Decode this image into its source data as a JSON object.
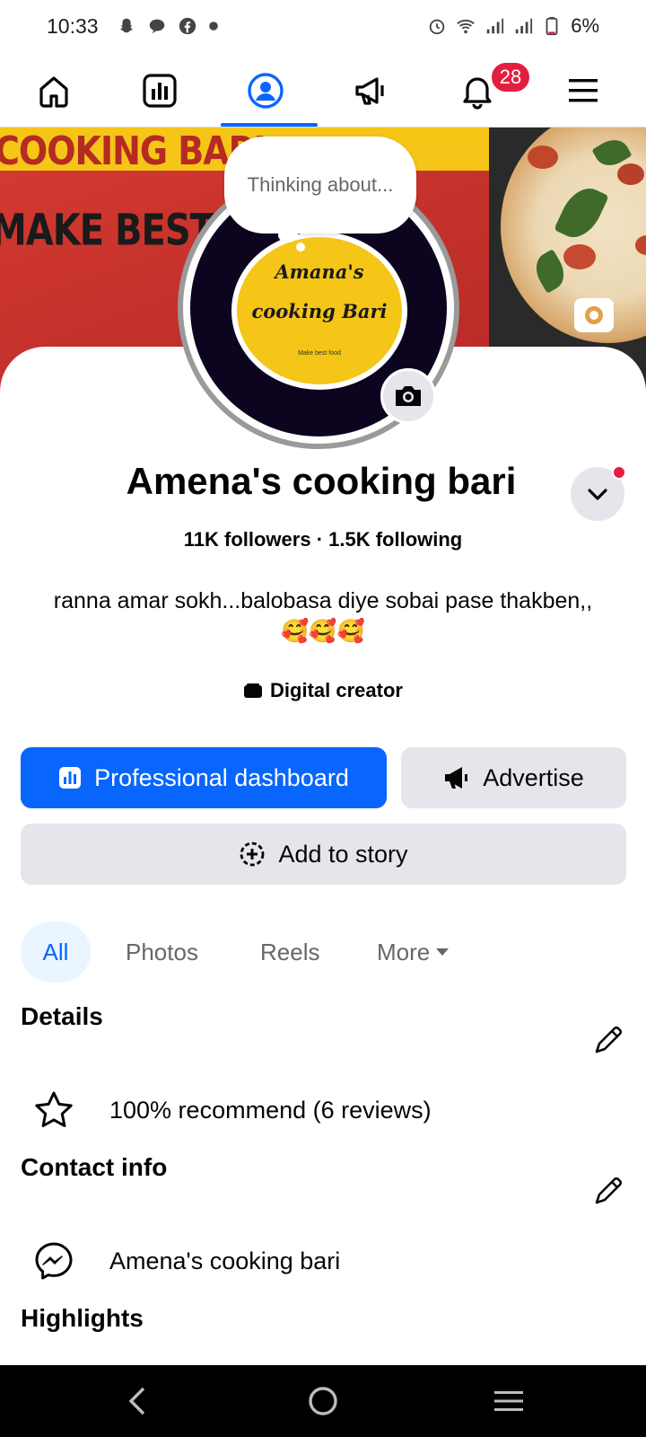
{
  "status_bar": {
    "time": "10:33",
    "battery": "6%",
    "left_icons": [
      "snapchat-icon",
      "chat-icon",
      "facebook-icon",
      "dot-icon"
    ],
    "right_icons": [
      "alarm-icon",
      "wifi-icon",
      "signal-icon",
      "signal-icon",
      "battery-icon"
    ]
  },
  "nav": {
    "items": [
      "home-icon",
      "dashboard-icon",
      "profile-icon",
      "megaphone-icon",
      "bell-icon",
      "menu-icon"
    ],
    "active": "profile",
    "notification_count": "28",
    "accent": "#0866ff",
    "badge_color": "#e41e3f"
  },
  "cover": {
    "text_line1": "COOKING BARI",
    "text_line2": "MAKE BEST FOO"
  },
  "avatar": {
    "line1": "Amana's",
    "line2": "cooking Bari",
    "small": "Make best food"
  },
  "thought_bubble": "Thinking about...",
  "profile": {
    "name": "Amena's cooking bari",
    "stats": "11K followers · 1.5K following",
    "bio": "ranna amar sokh...balobasa diye sobai pase thakben,,",
    "bio_emojis": "🥰🥰🥰",
    "category": "Digital creator"
  },
  "buttons": {
    "dashboard": "Professional dashboard",
    "advertise": "Advertise",
    "story": "Add to story"
  },
  "tabs": {
    "all": "All",
    "photos": "Photos",
    "reels": "Reels",
    "more": "More"
  },
  "details": {
    "title": "Details",
    "recommend": "100% recommend (6 reviews)"
  },
  "contact": {
    "title": "Contact info",
    "messenger": "Amena's cooking bari"
  },
  "highlights": {
    "title": "Highlights"
  }
}
